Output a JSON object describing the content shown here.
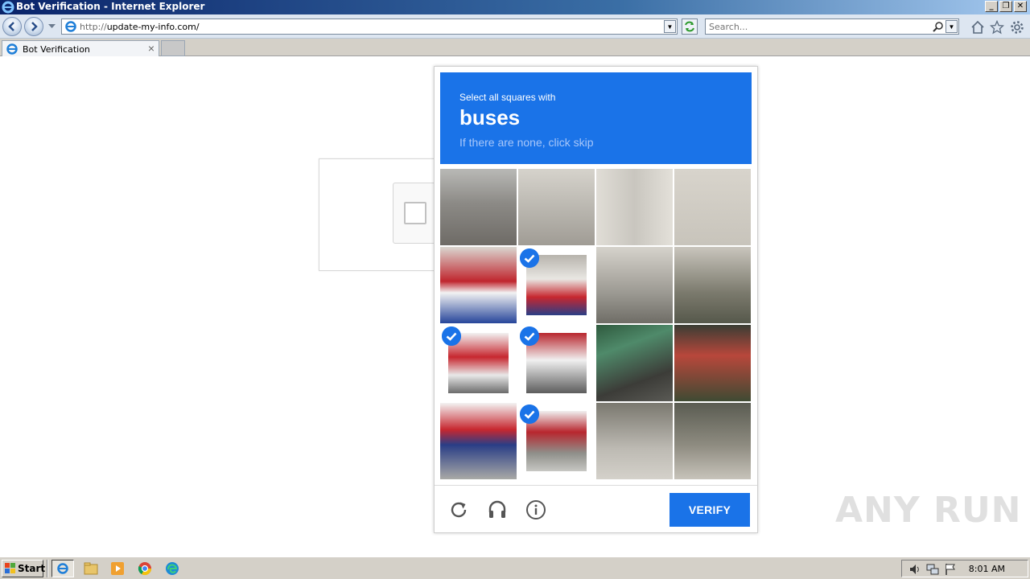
{
  "window": {
    "title": "Bot Verification - Internet Explorer"
  },
  "address_bar": {
    "protocol": "http://",
    "host": "update-my-info.com/"
  },
  "search": {
    "placeholder": "Search..."
  },
  "tabs": [
    {
      "label": "Bot Verification"
    }
  ],
  "challenge": {
    "instruction": "Select all squares with",
    "target": "buses",
    "hint": "If there are none, click skip",
    "grid": {
      "rows": 4,
      "cols": 4,
      "selected": [
        5,
        8,
        9,
        13
      ]
    },
    "verify_label": "VERIFY",
    "accent": "#1a73e8"
  },
  "watermark": {
    "text": "ANY RUN"
  },
  "taskbar": {
    "start_label": "Start",
    "clock": "8:01 AM"
  }
}
